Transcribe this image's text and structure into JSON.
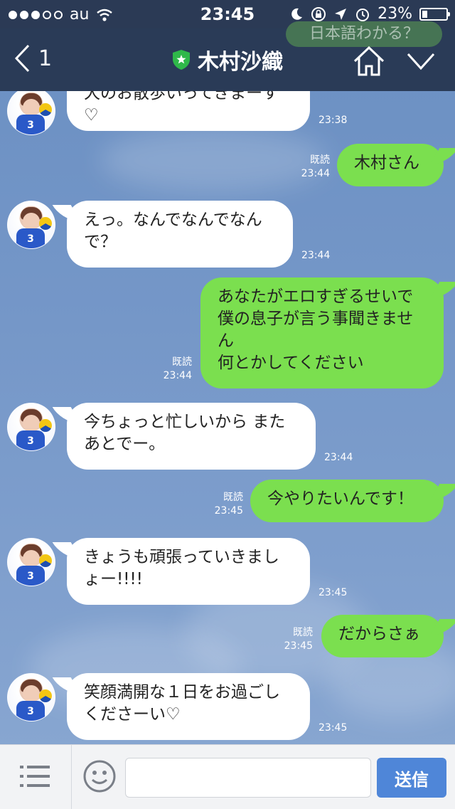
{
  "status_bar": {
    "carrier": "au",
    "time": "23:45",
    "battery_percent": "23%",
    "battery_level": 0.23
  },
  "header": {
    "back_count": "1",
    "contact_name": "木村沙織",
    "partial_top_message": "日本語わかる？"
  },
  "messages": [
    {
      "side": "in",
      "text": "犬のお散歩いってきまーす♡",
      "time": "23:38"
    },
    {
      "side": "out",
      "text": "木村さん",
      "read": "既読",
      "time": "23:44"
    },
    {
      "side": "in",
      "text": "えっ。なんでなんでなんで？",
      "time": "23:44"
    },
    {
      "side": "out",
      "text": "あなたがエロすぎるせいで僕の息子が言う事聞きません\n何とかしてください",
      "read": "既読",
      "time": "23:44"
    },
    {
      "side": "in",
      "text": "今ちょっと忙しいから またあとでー。",
      "time": "23:44"
    },
    {
      "side": "out",
      "text": "今やりたいんです！",
      "read": "既読",
      "time": "23:45"
    },
    {
      "side": "in",
      "text": "きょうも頑張っていきましょー!!!!",
      "time": "23:45"
    },
    {
      "side": "out",
      "text": "だからさぁ",
      "read": "既読",
      "time": "23:45"
    },
    {
      "side": "in",
      "text": "笑顔満開な１日をお過ごしくださーい♡",
      "time": "23:45"
    }
  ],
  "input_bar": {
    "send_label": "送信",
    "input_value": ""
  },
  "colors": {
    "nav_bg": "#283752",
    "incoming_bubble": "#ffffff",
    "outgoing_bubble": "#7bdf4f",
    "send_button": "#4f86d8",
    "shield_green": "#2fb84a"
  }
}
